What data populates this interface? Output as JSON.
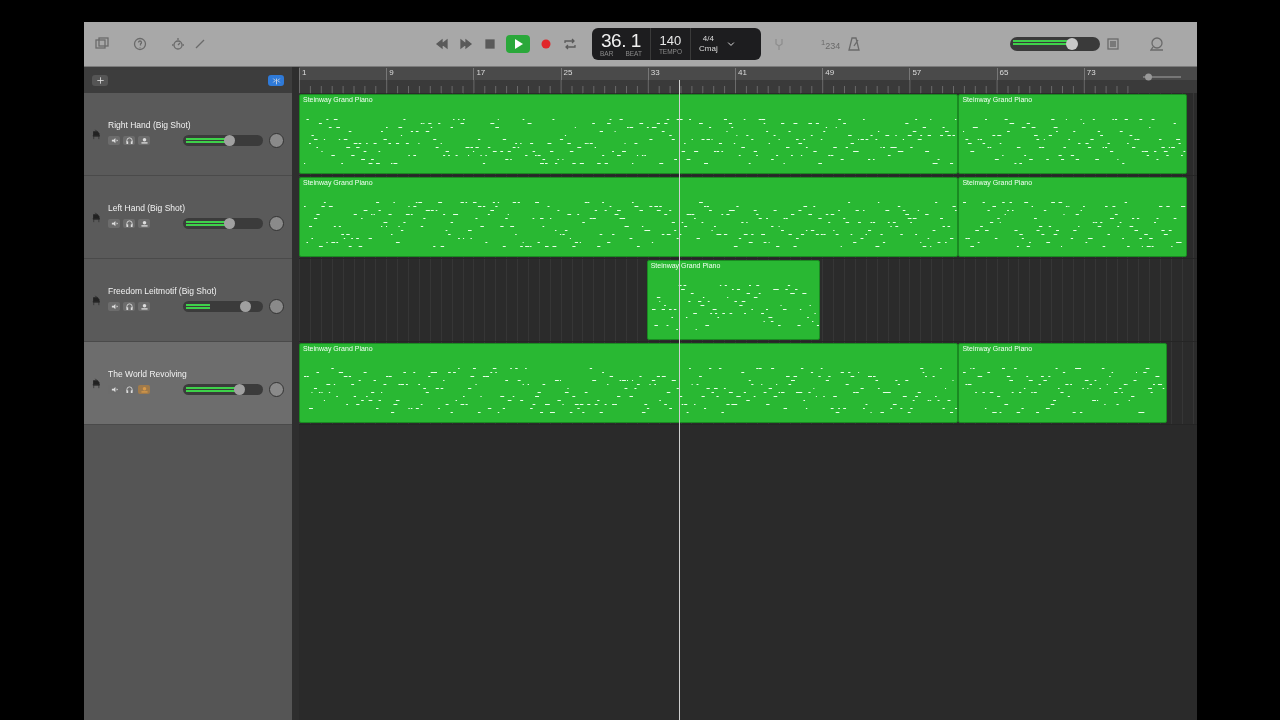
{
  "toolbar": {
    "playing": true,
    "lcd": {
      "bar_beat": "36. 1",
      "bar_label": "BAR",
      "beat_label": "BEAT",
      "tempo": "140",
      "tempo_label": "TEMPO",
      "time_signature": "4/4",
      "key": "Cmaj"
    },
    "count_in": "$^{1}$234",
    "master_volume": {
      "level": 0.68
    }
  },
  "ruler": {
    "markers": [
      "1",
      "9",
      "17",
      "25",
      "33",
      "41",
      "49",
      "57",
      "65",
      "73"
    ],
    "zoom": {
      "level": 0.05
    }
  },
  "playhead": {
    "level": 0.427
  },
  "tracks": [
    {
      "name": "Right Hand (Big Shot)",
      "selected": false,
      "muted": false,
      "solo": false,
      "record_enabled": false,
      "volume": {
        "level": 0.57
      },
      "meter": {
        "level": 0.57
      },
      "regions": [
        {
          "name": "Steinway Grand Piano"
        },
        {
          "name": "Steinway Grand Piano"
        }
      ]
    },
    {
      "name": "Left Hand (Big Shot)",
      "selected": false,
      "muted": false,
      "solo": false,
      "record_enabled": false,
      "volume": {
        "level": 0.57
      },
      "meter": {
        "level": 0.57
      },
      "regions": [
        {
          "name": "Steinway Grand Piano"
        },
        {
          "name": "Steinway Grand Piano"
        }
      ]
    },
    {
      "name": "Freedom Leitmotif (Big Shot)",
      "selected": false,
      "muted": false,
      "solo": false,
      "record_enabled": false,
      "volume": {
        "level": 0.78
      },
      "meter": {
        "level": 0.38
      },
      "regions": [
        {
          "name": "Steinway Grand Piano"
        }
      ]
    },
    {
      "name": "The World Revolving",
      "selected": true,
      "muted": false,
      "solo": false,
      "record_enabled": true,
      "volume": {
        "level": 0.7
      },
      "meter": {
        "level": 0.7
      },
      "regions": [
        {
          "name": "Steinway Grand Piano"
        },
        {
          "name": "Steinway Grand Piano"
        }
      ]
    }
  ]
}
